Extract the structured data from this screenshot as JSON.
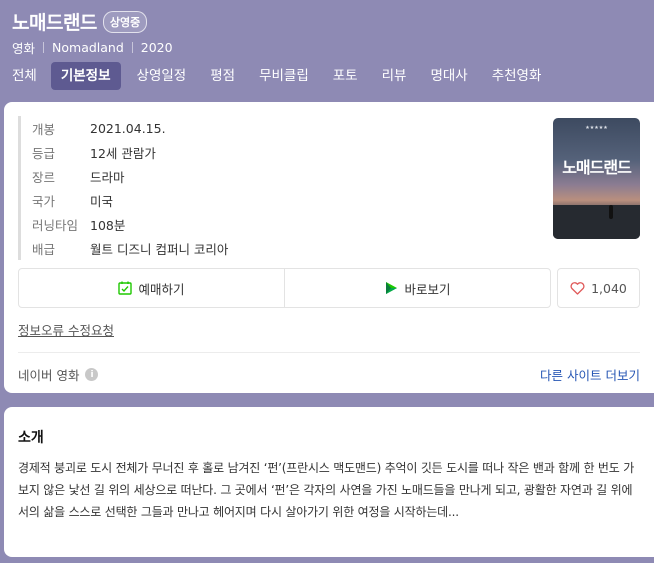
{
  "movie": {
    "title": "노매드랜드",
    "status_badge": "상영중",
    "category": "영화",
    "original_title": "Nomadland",
    "year": "2020"
  },
  "tabs": [
    {
      "label": "전체",
      "active": false
    },
    {
      "label": "기본정보",
      "active": true
    },
    {
      "label": "상영일정",
      "active": false
    },
    {
      "label": "평점",
      "active": false
    },
    {
      "label": "무비클립",
      "active": false
    },
    {
      "label": "포토",
      "active": false
    },
    {
      "label": "리뷰",
      "active": false
    },
    {
      "label": "명대사",
      "active": false
    },
    {
      "label": "추천영화",
      "active": false
    }
  ],
  "info": [
    {
      "key": "개봉",
      "value": "2021.04.15."
    },
    {
      "key": "등급",
      "value": "12세 관람가"
    },
    {
      "key": "장르",
      "value": "드라마"
    },
    {
      "key": "국가",
      "value": "미국"
    },
    {
      "key": "러닝타임",
      "value": "108분"
    },
    {
      "key": "배급",
      "value": "월트 디즈니 컴퍼니 코리아"
    }
  ],
  "poster": {
    "title": "노매드랜드"
  },
  "actions": {
    "reserve_label": "예매하기",
    "watch_label": "바로보기",
    "like_count": "1,040"
  },
  "report_link": "정보오류 수정요청",
  "source": {
    "label": "네이버 영화",
    "more_label": "다른 사이트 더보기"
  },
  "synopsis": {
    "heading": "소개",
    "text": "경제적 붕괴로 도시 전체가 무너진 후 홀로 남겨진 ‘펀’(프란시스 맥도맨드) 추억이 깃든 도시를 떠나 작은 밴과 함께 한 번도 가보지 않은 낯선 길 위의 세상으로 떠난다. 그 곳에서 ‘펀’은 각자의 사연을 가진 노매드들을 만나게 되고, 광활한 자연과 길 위에서의 삶을 스스로 선택한 그들과 만나고 헤어지며 다시 살아가기 위한 여정을 시작하는데..."
  },
  "colors": {
    "header_bg": "#8e8ab4",
    "active_tab_bg": "#5e5a91",
    "link_blue": "#2656b4",
    "reserve_icon_green": "#1ec800",
    "heart_icon": "#e05a5a"
  }
}
